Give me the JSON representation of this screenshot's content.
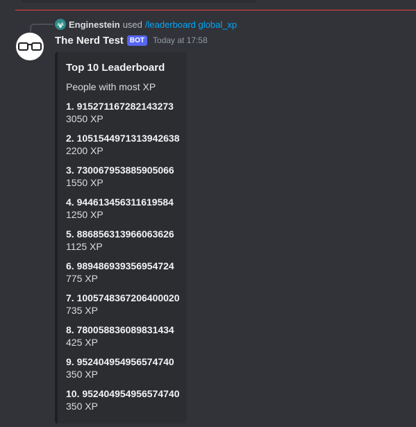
{
  "interaction": {
    "user": "Enginestein",
    "verb": "used",
    "command": "/leaderboard global_xp"
  },
  "message": {
    "author": "The Nerd Test",
    "badge": "BOT",
    "timestamp": "Today at 17:58"
  },
  "embed": {
    "title": "Top 10 Leaderboard",
    "description": "People with most XP",
    "fields": [
      {
        "name": "1. 915271167282143273",
        "value": "3050 XP"
      },
      {
        "name": "2. 1051544971313942638",
        "value": "2200 XP"
      },
      {
        "name": "3. 730067953885905066",
        "value": "1550 XP"
      },
      {
        "name": "4. 944613456311619584",
        "value": "1250 XP"
      },
      {
        "name": "5. 886856313966063626",
        "value": "1125 XP"
      },
      {
        "name": "6. 989486939356954724",
        "value": "775 XP"
      },
      {
        "name": "7. 1005748367206400020",
        "value": "735 XP"
      },
      {
        "name": "8. 780058836089831434",
        "value": "425 XP"
      },
      {
        "name": "9. 952404954956574740",
        "value": "350 XP"
      },
      {
        "name": "10. 952404954956574740",
        "value": "350 XP"
      }
    ]
  },
  "colors": {
    "background": "#313338",
    "embed_background": "#2b2d31",
    "embed_border": "#1e1f22",
    "new_messages_line": "#f23f43",
    "command_link": "#00a8fc",
    "bot_badge": "#5865f2"
  },
  "icons": {
    "bot_avatar": "glasses-icon",
    "user_mini_avatar": "user-avatar-icon"
  }
}
